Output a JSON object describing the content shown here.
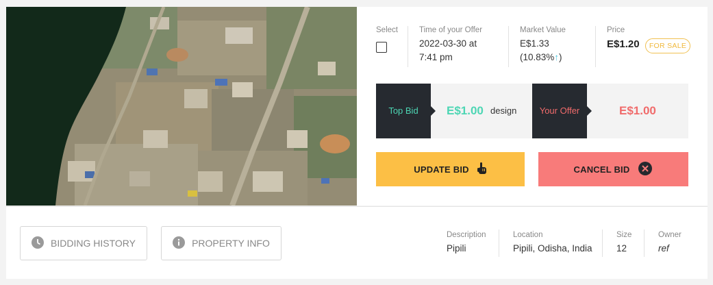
{
  "offer": {
    "select_label": "Select",
    "time_label": "Time of your Offer",
    "time_line1": "2022-03-30 at",
    "time_line2": "7:41 pm",
    "market_label": "Market Value",
    "market_value": "E$1.33",
    "market_change": "(10.83%",
    "market_change_close": ")",
    "price_label": "Price",
    "price_value": "E$1.20",
    "status_badge": "FOR SALE"
  },
  "bids": {
    "top_bid_label": "Top Bid",
    "top_bid_value": "E$1.00",
    "top_bidder": "design",
    "your_offer_label": "Your Offer",
    "your_offer_value": "E$1.00"
  },
  "actions": {
    "update_label": "UPDATE BID",
    "cancel_label": "CANCEL BID",
    "history_label": "BIDDING HISTORY",
    "info_label": "PROPERTY INFO"
  },
  "property": {
    "description_label": "Description",
    "description_value": "Pipili",
    "location_label": "Location",
    "location_value": "Pipili, Odisha, India",
    "size_label": "Size",
    "size_value": "12",
    "owner_label": "Owner",
    "owner_value": "ref"
  },
  "colors": {
    "accent_yellow": "#fcbf45",
    "accent_red": "#f87b7a",
    "top_bid_green": "#4dd6b4",
    "offer_red": "#f06b6b",
    "dark_panel": "#262a30"
  },
  "icons": {
    "update": "hand-pointer-icon",
    "cancel": "close-circle-icon",
    "history": "clock-icon",
    "info": "info-icon",
    "trend": "arrow-up-icon"
  }
}
